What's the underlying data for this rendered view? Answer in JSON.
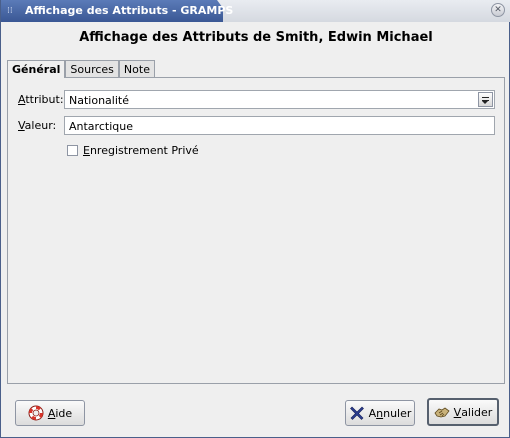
{
  "window": {
    "title": "Affichage des Attributs - GRAMPS",
    "grip_glyph": "⁞⁞",
    "close_glyph": "✕"
  },
  "dialog": {
    "heading": "Affichage des Attributs de Smith, Edwin Michael"
  },
  "tabs": [
    {
      "label": "Général",
      "active": true
    },
    {
      "label": "Sources",
      "active": false
    },
    {
      "label": "Note",
      "active": false
    }
  ],
  "general": {
    "attribute_label_mnemonic": "A",
    "attribute_label_rest": "ttribut:",
    "attribute_value": "Nationalité",
    "value_label_mnemonic": "V",
    "value_label_rest": "aleur:",
    "value_value": "Antarctique",
    "private_mnemonic": "E",
    "private_rest": "nregistrement Privé",
    "private_checked": false
  },
  "buttons": {
    "help_mnemonic": "A",
    "help_rest": "ide",
    "help_icon": "lifebuoy-icon",
    "cancel_prefix": "A",
    "cancel_mnemonic": "n",
    "cancel_rest": "nuler",
    "cancel_icon": "cross-icon",
    "ok_mnemonic": "V",
    "ok_rest": "alider",
    "ok_icon": "handshake-icon"
  },
  "colors": {
    "title_bar": "#3a5794",
    "title_text": "#ffffff",
    "cancel_cross": "#2b3d8f",
    "help_ring": "#d8342a"
  }
}
